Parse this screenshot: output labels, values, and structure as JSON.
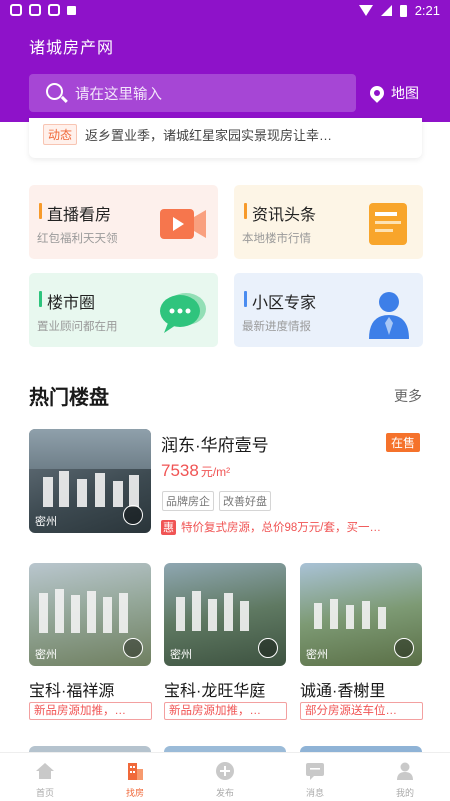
{
  "status_bar": {
    "time": "2:21"
  },
  "header": {
    "title": "诸城房产网",
    "search_placeholder": "请在这里输入",
    "map_label": "地图"
  },
  "ticker": {
    "tag": "动态",
    "text": "返乡置业季，诸城红星家园实景现房让幸…"
  },
  "features": [
    {
      "title": "直播看房",
      "sub": "红包福利天天领",
      "icon": "video-icon"
    },
    {
      "title": "资讯头条",
      "sub": "本地楼市行情",
      "icon": "news-icon"
    },
    {
      "title": "楼市圈",
      "sub": "置业顾问都在用",
      "icon": "chat-icon"
    },
    {
      "title": "小区专家",
      "sub": "最新进度情报",
      "icon": "expert-icon"
    }
  ],
  "section": {
    "title": "热门楼盘",
    "more": "更多"
  },
  "featured": {
    "name": "润东·华府壹号",
    "status": "在售",
    "price": "7538",
    "price_unit": "元/m²",
    "tags": [
      "品牌房企",
      "改善好盘"
    ],
    "promo_icon": "惠",
    "promo": "特价复式房源，总价98万元/套，买一…",
    "image_label": "密州"
  },
  "listings": [
    {
      "name": "宝科·福祥源",
      "promo": "新品房源加推，…",
      "image_label": "密州"
    },
    {
      "name": "宝科·龙旺华庭",
      "promo": "新品房源加推，…",
      "image_label": "密州"
    },
    {
      "name": "诚通·香榭里",
      "promo": "部分房源送车位…",
      "image_label": "密州"
    }
  ],
  "bottom_nav": [
    {
      "label": "首页",
      "icon": "home-icon",
      "active": false
    },
    {
      "label": "找房",
      "icon": "building-icon",
      "active": true
    },
    {
      "label": "发布",
      "icon": "plus-circle-icon",
      "active": false
    },
    {
      "label": "消息",
      "icon": "message-icon",
      "active": false
    },
    {
      "label": "我的",
      "icon": "user-icon",
      "active": false
    }
  ],
  "colors": {
    "brand": "#8e12c9",
    "accent": "#f0693a",
    "price": "#f05454"
  }
}
